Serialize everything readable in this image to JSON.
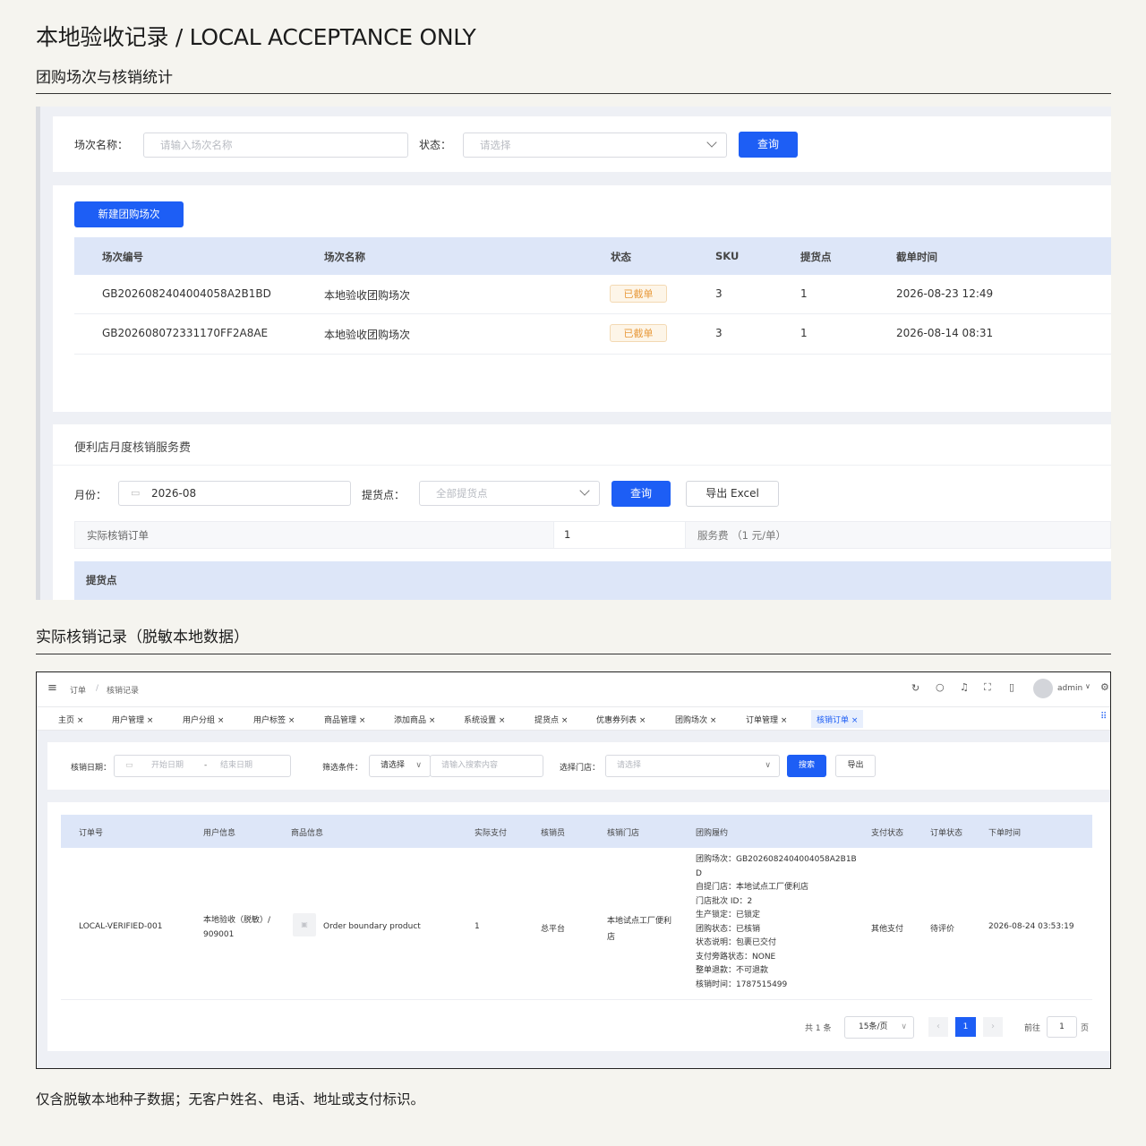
{
  "header": {
    "title": "本地验收记录 / LOCAL ACCEPTANCE ONLY",
    "section1": "团购场次与核销统计",
    "section2": "实际核销记录（脱敏本地数据）"
  },
  "shot1": {
    "search": {
      "name_label": "场次名称：",
      "name_placeholder": "请输入场次名称",
      "status_label": "状态：",
      "status_placeholder": "请选择",
      "query": "查询"
    },
    "create_button": "新建团购场次",
    "table": {
      "headers": [
        "场次编号",
        "场次名称",
        "状态",
        "SKU",
        "提货点",
        "截单时间"
      ],
      "rows": [
        {
          "id": "GB2026082404004058A2B1BD",
          "name": "本地验收团购场次",
          "status": "已截单",
          "sku": "3",
          "points": "1",
          "cutoff": "2026-08-23 12:49"
        },
        {
          "id": "GB202608072331170FF2A8AE",
          "name": "本地验收团购场次",
          "status": "已截单",
          "sku": "3",
          "points": "1",
          "cutoff": "2026-08-14 08:31"
        }
      ]
    },
    "fee": {
      "title": "便利店月度核销服务费",
      "month_label": "月份：",
      "month_value": "2026-08",
      "point_label": "提货点：",
      "point_placeholder": "全部提货点",
      "query": "查询",
      "export": "导出 Excel",
      "summary": {
        "orders_label": "实际核销订单",
        "orders_value": "1",
        "fee_label": "服务费 （1 元/单）"
      },
      "point_header": "提货点"
    }
  },
  "shot2": {
    "breadcrumb": {
      "root": "订单",
      "sep": "/",
      "current": "核销记录"
    },
    "user": "admin",
    "tabs": [
      "主页",
      "用户管理",
      "用户分组",
      "用户标签",
      "商品管理",
      "添加商品",
      "系统设置",
      "提货点",
      "优惠券列表",
      "团购场次",
      "订单管理",
      "核销订单"
    ],
    "filters": {
      "date_label": "核销日期：",
      "start": "开始日期",
      "dash": "-",
      "end": "结束日期",
      "cond_label": "筛选条件：",
      "cond_value": "请选择",
      "keyword_placeholder": "请输入搜索内容",
      "store_label": "选择门店：",
      "store_placeholder": "请选择",
      "search": "搜索",
      "export": "导出"
    },
    "table": {
      "headers": [
        "订单号",
        "用户信息",
        "商品信息",
        "实际支付",
        "核销员",
        "核销门店",
        "团购履约",
        "支付状态",
        "订单状态",
        "下单时间"
      ],
      "row": {
        "order_no": "LOCAL-VERIFIED-001",
        "user_line1": "本地验收（脱敏）/",
        "user_line2": "909001",
        "product": "Order boundary product",
        "paid": "1",
        "operator": "总平台",
        "store_line1": "本地试点工厂便利",
        "store_line2": "店",
        "fulfilment": [
          "团购场次：GB2026082404004058A2B1B",
          "D",
          "自提门店：本地试点工厂便利店",
          "门店批次 ID：2",
          "生产锁定：已锁定",
          "团购状态：已核销",
          "状态说明：包裹已交付",
          "支付旁路状态：NONE",
          "整单退款：不可退款",
          "核销时间：1787515499"
        ],
        "pay_status": "其他支付",
        "order_status": "待评价",
        "time": "2026-08-24 03:53:19"
      }
    },
    "pagination": {
      "total": "共 1 条",
      "size": "15条/页",
      "page": "1",
      "goto": "前往",
      "goto_value": "1",
      "page_unit": "页"
    }
  },
  "footer": "仅含脱敏本地种子数据；无客户姓名、电话、地址或支付标识。"
}
